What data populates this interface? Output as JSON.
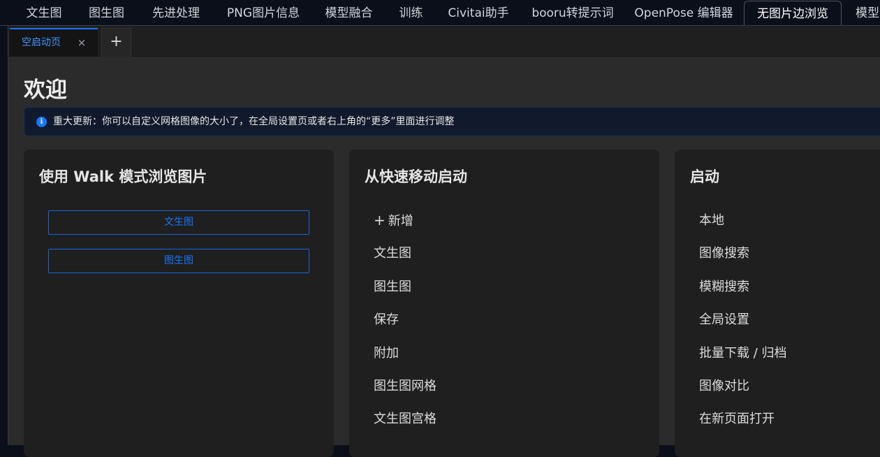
{
  "main_tabs": [
    {
      "label": "文生图"
    },
    {
      "label": "图生图"
    },
    {
      "label": "先进处理"
    },
    {
      "label": "PNG图片信息"
    },
    {
      "label": "模型融合"
    },
    {
      "label": "训练"
    },
    {
      "label": "Civitai助手"
    },
    {
      "label": "booru转提示词"
    },
    {
      "label": "OpenPose 编辑器"
    },
    {
      "label": "无图片边浏览"
    },
    {
      "label": "模型"
    }
  ],
  "active_main_tab": "无图片边浏览",
  "sub_tabs": {
    "active_label": "空启动页",
    "close_glyph": "×",
    "add_glyph": "+"
  },
  "welcome": {
    "title": "欢迎",
    "alert": "重大更新：你可以自定义网格图像的大小了，在全局设置页或者右上角的“更多”里面进行调整"
  },
  "walk_card": {
    "title": "使用 Walk 模式浏览图片",
    "buttons": [
      "文生图",
      "图生图"
    ]
  },
  "quick_move_card": {
    "title": "从快速移动启动",
    "add_label": "新增",
    "items": [
      "文生图",
      "图生图",
      "保存",
      "附加",
      "图生图网格",
      "文生图宫格"
    ]
  },
  "launch_card": {
    "title": "启动",
    "items": [
      "本地",
      "图像搜索",
      "模糊搜索",
      "全局设置",
      "批量下载 / 归档",
      "图像对比",
      "在新页面打开"
    ]
  },
  "icons": {
    "info": "info-circle-icon",
    "close": "close-icon",
    "add": "plus-icon"
  },
  "colors": {
    "accent": "#1677ff",
    "background": "#0b0f19",
    "panel": "#1f1f1f",
    "alert_bg": "#111a2c"
  }
}
